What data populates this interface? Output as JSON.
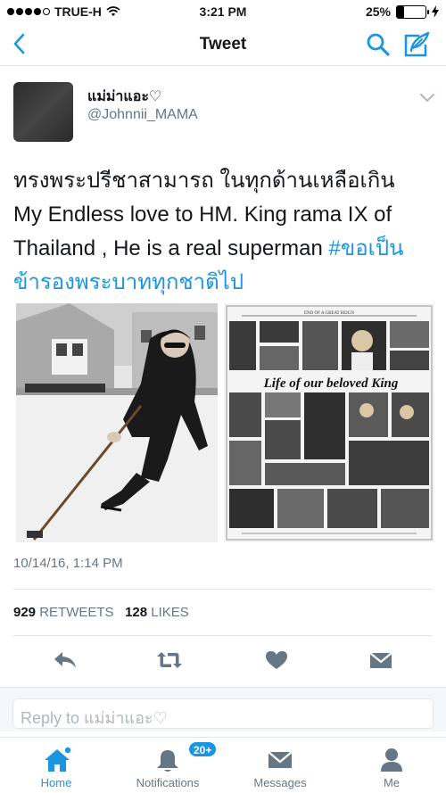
{
  "status_bar": {
    "carrier": "TRUE-H",
    "time": "3:21 PM",
    "battery": "25%",
    "battery_level": 0.25
  },
  "nav": {
    "title": "Tweet",
    "icons": [
      "back-chevron-icon",
      "search-icon",
      "compose-icon"
    ]
  },
  "tweet": {
    "display_name": "แม่ม่าแอะ♡",
    "screen_name": "@Johnnii_MAMA",
    "text_line1": "ทรงพระปรีชาสามารถ ในทุกด้านเหลือเกิน",
    "text_line2": "My Endless love to HM. King rama IX of",
    "text_line3": "Thailand , He is a real superman ",
    "hashtag": "#ขอเป็นข้ารองพระบาททุกชาติไป",
    "hashtag_part1": "#ขอเป็น",
    "hashtag_part2": "ข้ารองพระบาททุกชาติไป",
    "timestamp": "10/14/16, 1:14 PM",
    "retweets_count": "929",
    "retweets_label": "RETWEETS",
    "likes_count": "128",
    "likes_label": "LIKES",
    "media": [
      {
        "kind": "photo",
        "caption": ""
      },
      {
        "kind": "photo",
        "header_text": "END OF A GREAT REIGN",
        "title_text": "Life of our beloved King"
      }
    ]
  },
  "reply": {
    "placeholder": "Reply to แม่ม่าแอะ♡"
  },
  "tab_bar": {
    "tabs": [
      {
        "label": "Home",
        "icon": "home-icon",
        "active": true
      },
      {
        "label": "Notifications",
        "icon": "bell-icon",
        "badge": "20+"
      },
      {
        "label": "Messages",
        "icon": "envelope-icon"
      },
      {
        "label": "Me",
        "icon": "person-icon"
      }
    ]
  },
  "colors": {
    "accent": "#1b95e0",
    "text": "#14171a",
    "secondary": "#657786",
    "divider": "#e1e8ed"
  }
}
